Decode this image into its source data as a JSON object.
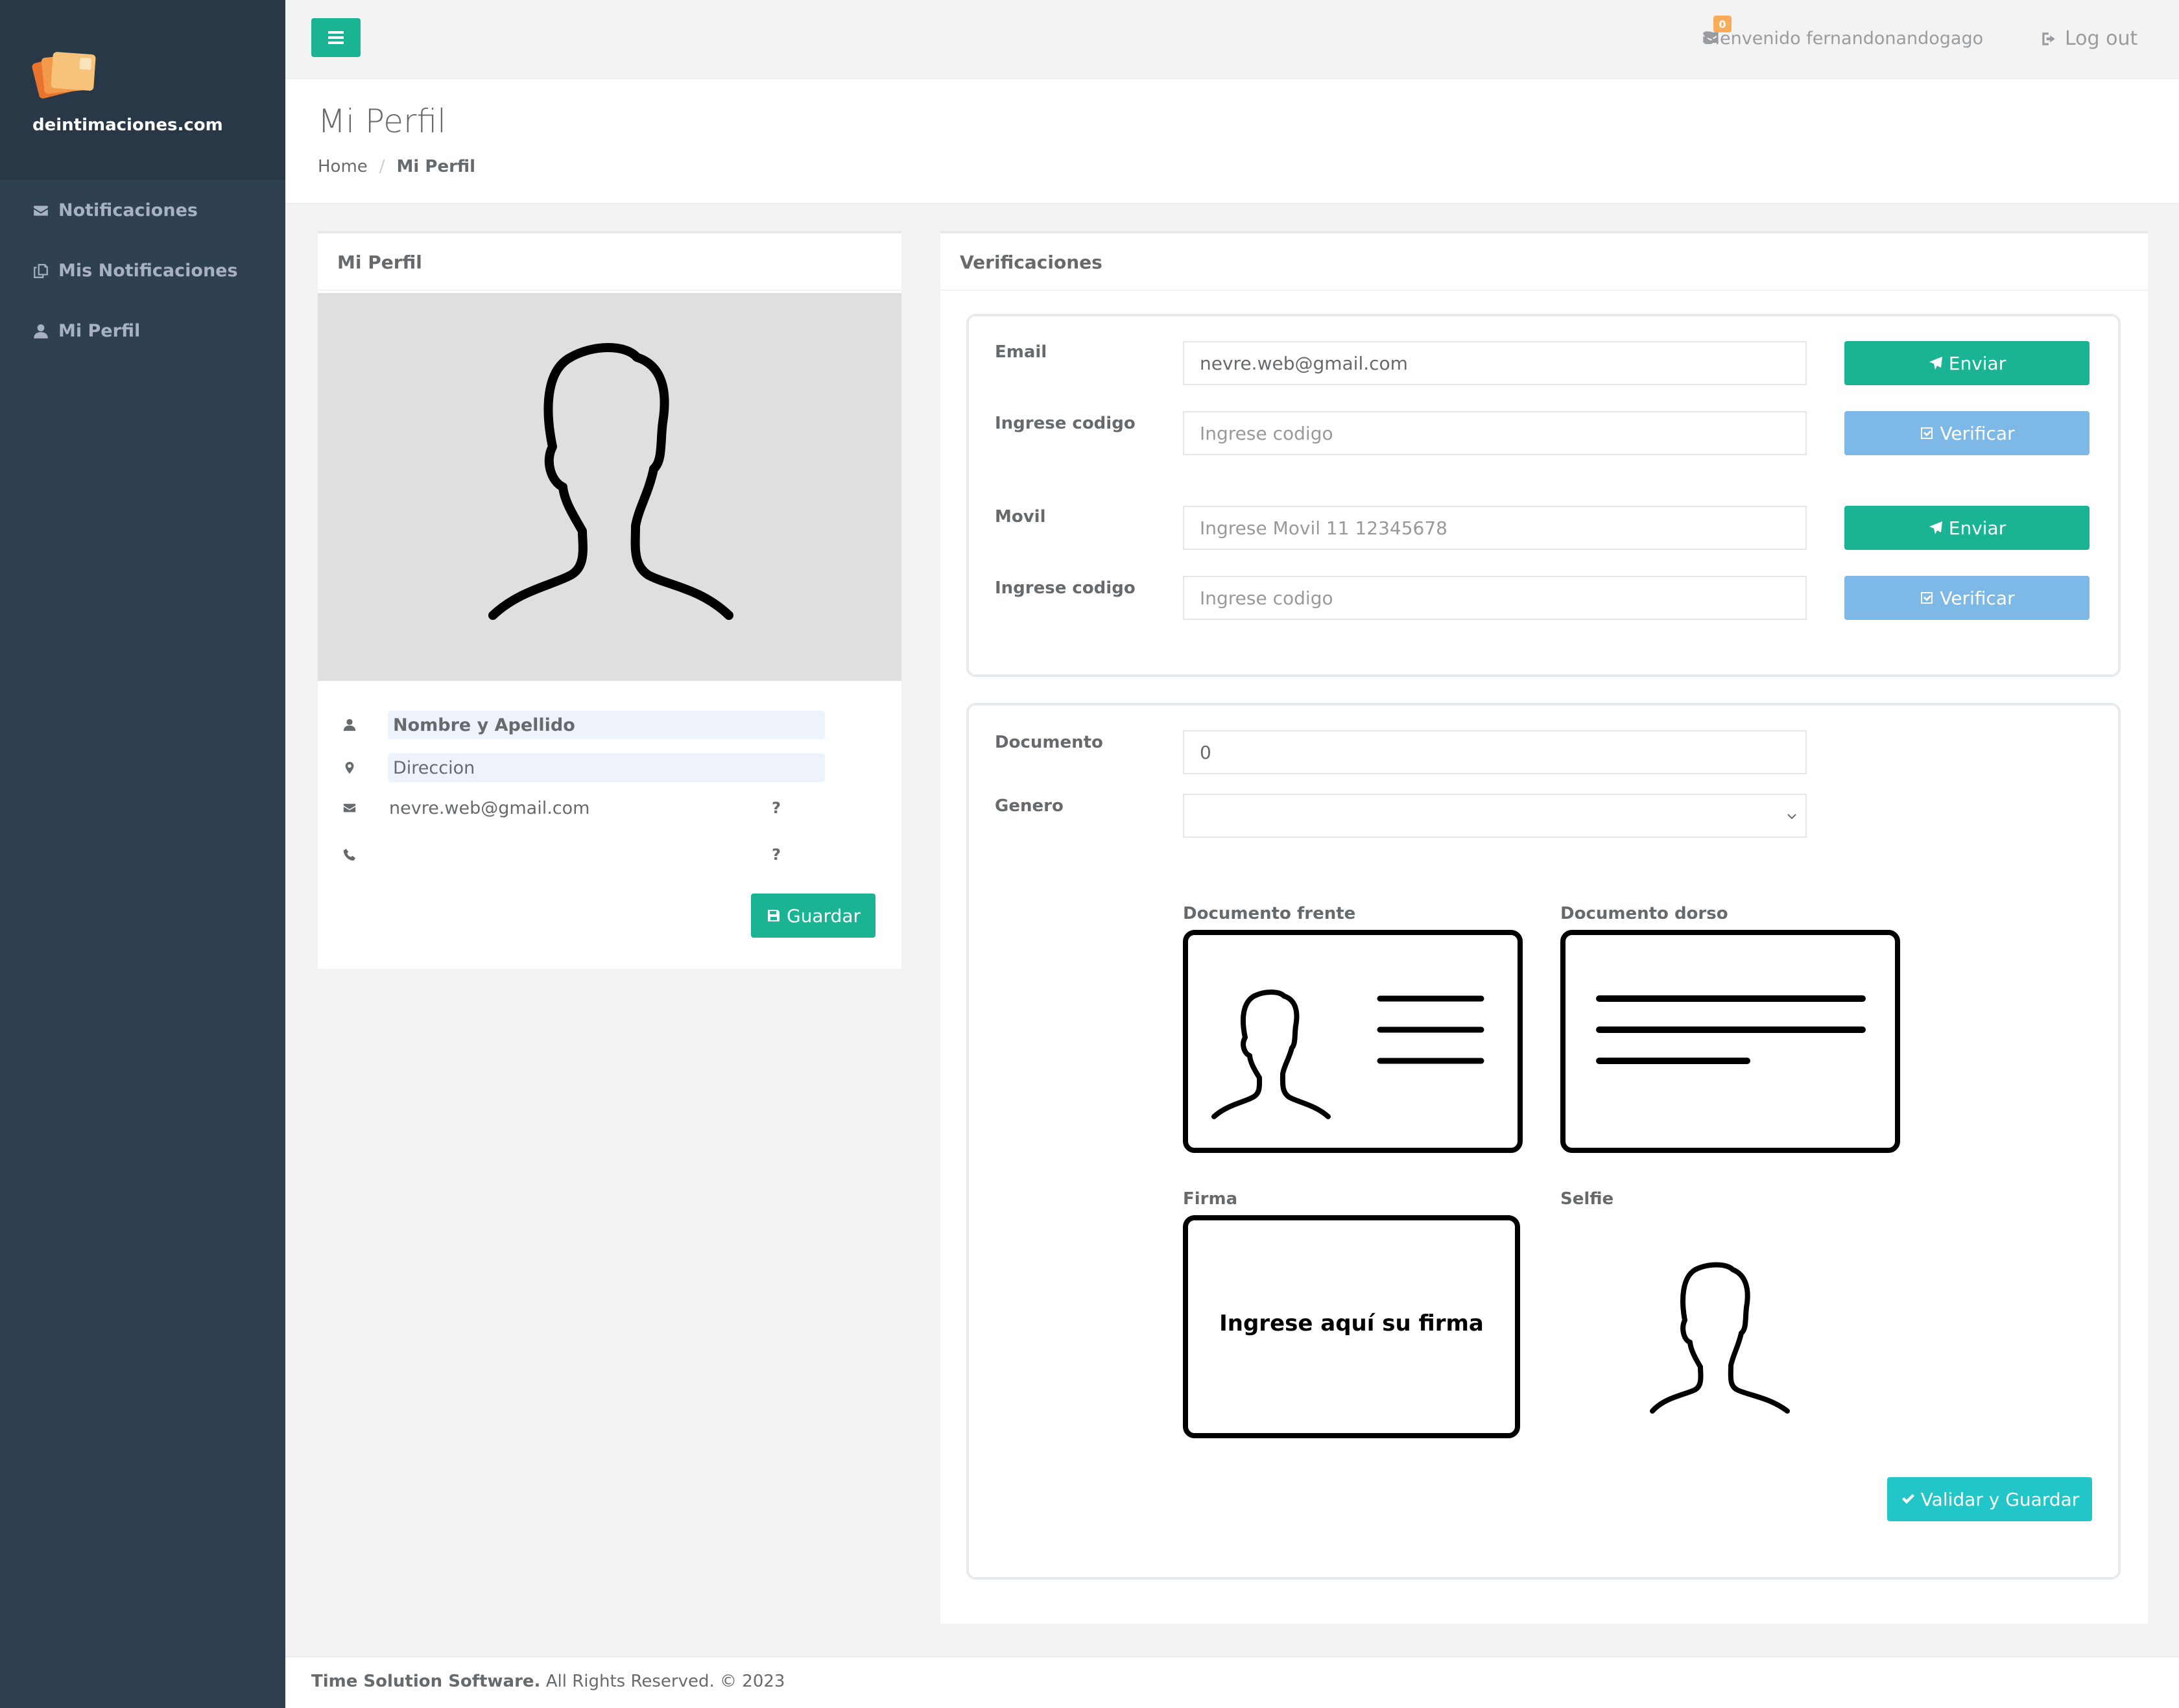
{
  "sidebar": {
    "brand": "deintimaciones.com",
    "items": [
      {
        "label": "Notificaciones",
        "icon": "envelope-icon"
      },
      {
        "label": "Mis Notificaciones",
        "icon": "copy-icon"
      },
      {
        "label": "Mi Perfil",
        "icon": "user-icon"
      }
    ]
  },
  "topbar": {
    "welcome": "Bienvenido fernandonandogago",
    "mail_count": "0",
    "logout": "Log out"
  },
  "heading": {
    "title": "Mi Perfil",
    "breadcrumb": [
      "Home",
      "Mi Perfil"
    ]
  },
  "profile": {
    "title": "Mi Perfil",
    "name_placeholder": "Nombre y Apellido",
    "address_placeholder": "Direccion",
    "email": "nevre.web@gmail.com",
    "email_status": "?",
    "phone": "",
    "phone_status": "?",
    "save_label": "Guardar"
  },
  "verification": {
    "title": "Verificaciones",
    "email_label": "Email",
    "email_value": "nevre.web@gmail.com",
    "code_label": "Ingrese codigo",
    "code_placeholder": "Ingrese codigo",
    "send_label": "Enviar",
    "verify_label": "Verificar",
    "mobile_label": "Movil",
    "mobile_placeholder": "Ingrese Movil 11 12345678"
  },
  "document": {
    "doc_label": "Documento",
    "doc_value": "0",
    "gender_label": "Genero",
    "gender_value": "",
    "front_label": "Documento frente",
    "back_label": "Documento dorso",
    "signature_label": "Firma",
    "signature_prompt": "Ingrese aquí su firma",
    "selfie_label": "Selfie",
    "submit_label": "Validar y Guardar"
  },
  "footer": {
    "company": "Time Solution Software.",
    "rights": "All Rights Reserved. © 2023"
  },
  "colors": {
    "sidebar": "#2f4050",
    "primary": "#1ab394",
    "info": "#7eb8e6",
    "teal": "#23c6c8",
    "badge": "#f8ac59"
  }
}
